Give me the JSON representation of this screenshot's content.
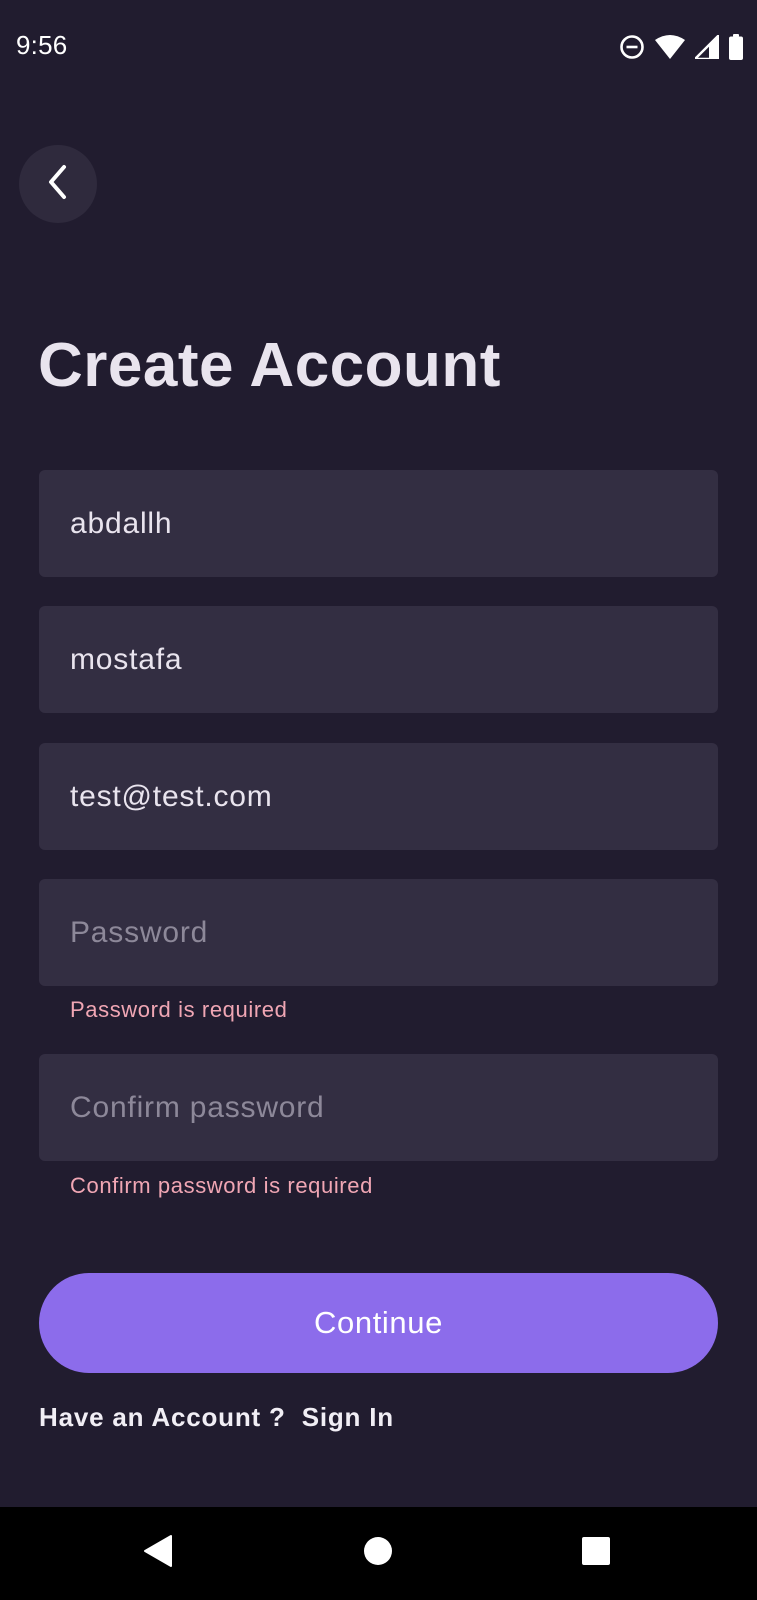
{
  "status_bar": {
    "time": "9:56",
    "icons": [
      "do-not-disturb-icon",
      "wifi-icon",
      "cellular-signal-icon",
      "battery-icon"
    ]
  },
  "header": {
    "back_icon": "chevron-left-icon",
    "title": "Create Account"
  },
  "form": {
    "first_name": {
      "value": "abdallh",
      "placeholder": ""
    },
    "last_name": {
      "value": "mostafa",
      "placeholder": ""
    },
    "email": {
      "value": "test@test.com",
      "placeholder": ""
    },
    "password": {
      "value": "",
      "placeholder": "Password",
      "error": "Password is required"
    },
    "confirm_password": {
      "value": "",
      "placeholder": "Confirm password",
      "error": "Confirm password is required"
    }
  },
  "actions": {
    "continue_label": "Continue",
    "have_account_text": "Have an Account ?",
    "sign_in_label": "Sign In"
  },
  "nav_bar": {
    "buttons": [
      "back-triangle-icon",
      "home-circle-icon",
      "recents-square-icon"
    ]
  },
  "colors": {
    "background": "#211c2f",
    "field_background": "#332e42",
    "accent": "#8c6ceb",
    "error": "#f0a6b4",
    "title": "#e9e4ee"
  }
}
